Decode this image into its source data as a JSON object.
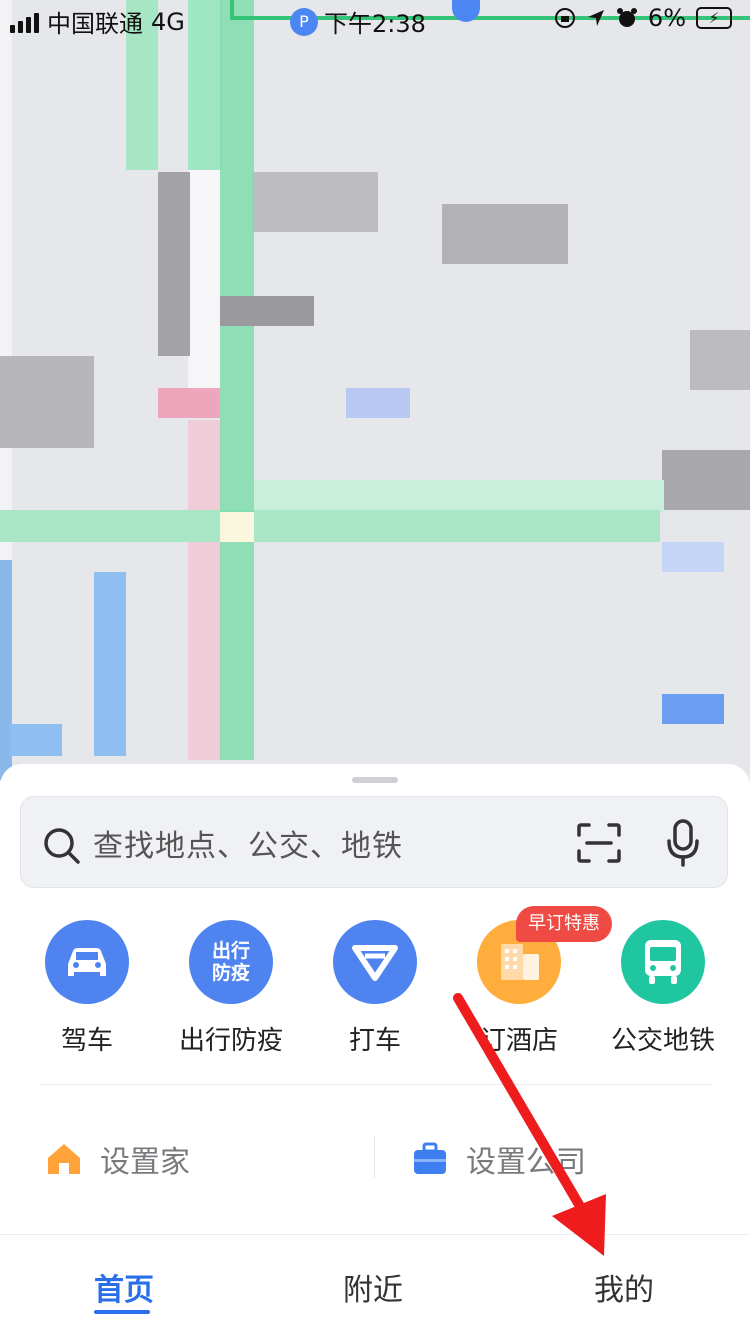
{
  "status_bar": {
    "carrier": "中国联通",
    "network": "4G",
    "time": "下午2:38",
    "battery": "6%"
  },
  "search": {
    "placeholder": "查找地点、公交、地铁",
    "icons": [
      "search-icon",
      "scan-icon",
      "mic-icon"
    ]
  },
  "shortcuts": [
    {
      "label": "驾车",
      "icon": "car-icon",
      "color": "#4f84f0"
    },
    {
      "label": "出行防疫",
      "icon_text": "出行\n防疫",
      "icon": "epidemic-icon",
      "color": "#4f84f0"
    },
    {
      "label": "打车",
      "icon": "taxi-icon",
      "color": "#4f84f0"
    },
    {
      "label": "订酒店",
      "icon": "hotel-icon",
      "color": "#ffae3d",
      "badge": "早订特惠"
    },
    {
      "label": "公交地铁",
      "icon": "bus-icon",
      "color": "#1fc6a0"
    }
  ],
  "quick_links": {
    "home": "设置家",
    "company": "设置公司"
  },
  "tabs": [
    {
      "label": "首页",
      "active": true
    },
    {
      "label": "附近",
      "active": false
    },
    {
      "label": "我的",
      "active": false
    }
  ],
  "colors": {
    "accent": "#2b6fe8",
    "annotation_arrow": "#ee1c1c",
    "promo_badge": "#ef4a44"
  }
}
